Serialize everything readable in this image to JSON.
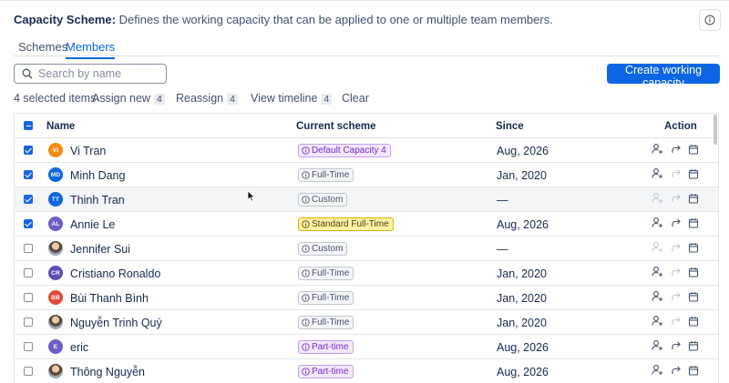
{
  "header": {
    "title": "Capacity Scheme:",
    "description": "Defines the working capacity that can be applied to one or multiple team members."
  },
  "tabs": [
    {
      "label": "Schemes",
      "active": false
    },
    {
      "label": "Members",
      "active": true
    }
  ],
  "search": {
    "placeholder": "Search by name",
    "value": ""
  },
  "create_button": "Create working capacity",
  "toolbar": {
    "selected": "4 selected items",
    "assign_label": "Assign new",
    "assign_count": "4",
    "reassign_label": "Reassign",
    "reassign_count": "4",
    "timeline_label": "View timeline",
    "timeline_count": "4",
    "clear": "Clear"
  },
  "table": {
    "headers": {
      "name": "Name",
      "scheme": "Current scheme",
      "since": "Since",
      "action": "Action"
    },
    "rows": [
      {
        "checked": true,
        "initials": "VI",
        "avatar_color": "#f18d13",
        "name": "Vi Tran",
        "scheme": "Default Capacity 4",
        "scheme_style": "purple",
        "since": "Aug, 2026",
        "reassign_enabled": true
      },
      {
        "checked": true,
        "initials": "MD",
        "avatar_color": "#0c66e4",
        "name": "Minh Dang",
        "scheme": "Full-Time",
        "scheme_style": "gray",
        "since": "Jan, 2020",
        "reassign_enabled": false
      },
      {
        "checked": true,
        "initials": "TT",
        "avatar_color": "#0c66e4",
        "name": "Thinh Tran",
        "scheme": "Custom",
        "scheme_style": "gray",
        "since": "—",
        "reassign_enabled": false,
        "assign_enabled": false,
        "hover": true
      },
      {
        "checked": true,
        "initials": "AL",
        "avatar_color": "#6e5dc6",
        "name": "Annie Le",
        "scheme": "Standard Full-Time",
        "scheme_style": "yellow",
        "since": "Aug, 2026",
        "reassign_enabled": true
      },
      {
        "checked": false,
        "initials": "",
        "avatar_color": "",
        "photo": true,
        "name": "Jennifer Sui",
        "scheme": "Custom",
        "scheme_style": "gray",
        "since": "—",
        "reassign_enabled": false,
        "assign_enabled": false
      },
      {
        "checked": false,
        "initials": "CR",
        "avatar_color": "#5e4db2",
        "name": "Cristiano Ronaldo",
        "scheme": "Full-Time",
        "scheme_style": "gray",
        "since": "Jan, 2020",
        "reassign_enabled": false
      },
      {
        "checked": false,
        "initials": "BB",
        "avatar_color": "#e34935",
        "name": "Bùi Thanh Bình",
        "scheme": "Full-Time",
        "scheme_style": "gray",
        "since": "Jan, 2020",
        "reassign_enabled": false
      },
      {
        "checked": false,
        "initials": "",
        "avatar_color": "",
        "photo": true,
        "name": "Nguyễn Trinh Quý",
        "scheme": "Full-Time",
        "scheme_style": "gray",
        "since": "Jan, 2020",
        "reassign_enabled": false
      },
      {
        "checked": false,
        "initials": "E",
        "avatar_color": "#6e5dc6",
        "name": "eric",
        "scheme": "Part-time",
        "scheme_style": "purple",
        "since": "Aug, 2026",
        "reassign_enabled": true
      },
      {
        "checked": false,
        "initials": "",
        "avatar_color": "",
        "photo": true,
        "name": "Thông Nguyễn",
        "scheme": "Part-time",
        "scheme_style": "purple",
        "since": "Aug, 2026",
        "reassign_enabled": true
      }
    ]
  },
  "icons": {
    "info": "info-icon",
    "search": "search-icon",
    "assign": "user-plus-icon",
    "reassign": "redo-arrow-icon",
    "timeline": "calendar-icon",
    "cursor": "mouse-pointer-icon"
  },
  "colors": {
    "accent": "#0c66e4",
    "checkbox": "#1d65e0",
    "disabled_icon": "#c1c7d0"
  }
}
